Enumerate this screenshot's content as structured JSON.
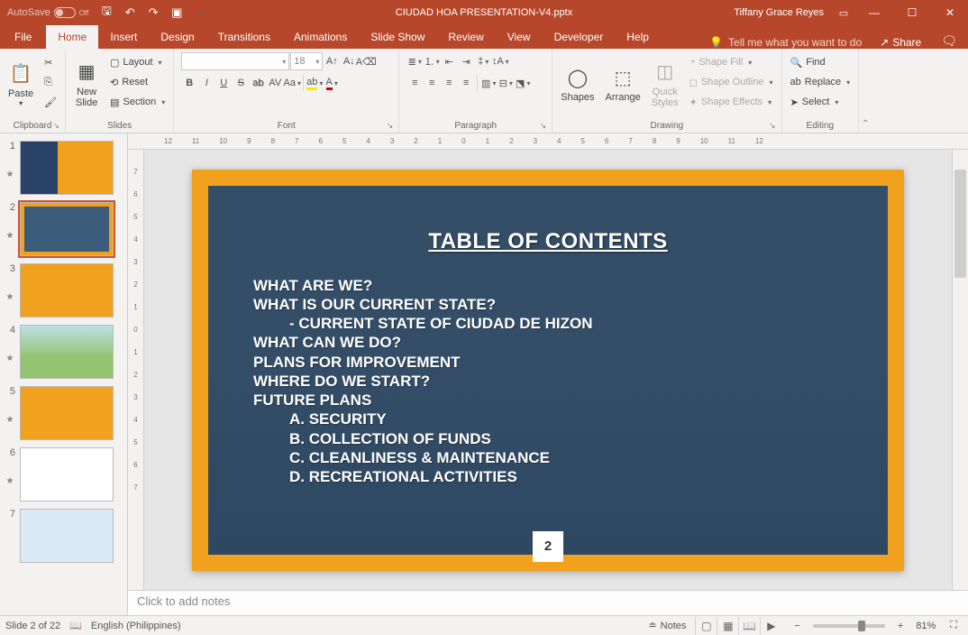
{
  "titlebar": {
    "autosave": "AutoSave",
    "autosave_state": "Off",
    "doc_title": "CIUDAD HOA PRESENTATION-V4.pptx",
    "user": "Tiffany Grace Reyes"
  },
  "tabs": {
    "file": "File",
    "home": "Home",
    "insert": "Insert",
    "design": "Design",
    "transitions": "Transitions",
    "animations": "Animations",
    "slideshow": "Slide Show",
    "review": "Review",
    "view": "View",
    "developer": "Developer",
    "help": "Help",
    "tellme": "Tell me what you want to do",
    "share": "Share"
  },
  "ribbon": {
    "clipboard": {
      "label": "Clipboard",
      "paste": "Paste"
    },
    "slides": {
      "label": "Slides",
      "newslide": "New\nSlide",
      "layout": "Layout",
      "reset": "Reset",
      "section": "Section"
    },
    "font": {
      "label": "Font",
      "size": "18"
    },
    "paragraph": {
      "label": "Paragraph"
    },
    "drawing": {
      "label": "Drawing",
      "shapes": "Shapes",
      "arrange": "Arrange",
      "quick": "Quick\nStyles",
      "fill": "Shape Fill",
      "outline": "Shape Outline",
      "effects": "Shape Effects"
    },
    "editing": {
      "label": "Editing",
      "find": "Find",
      "replace": "Replace",
      "select": "Select"
    }
  },
  "ruler_h": [
    "12",
    "11",
    "10",
    "9",
    "8",
    "7",
    "6",
    "5",
    "4",
    "3",
    "2",
    "1",
    "0",
    "1",
    "2",
    "3",
    "4",
    "5",
    "6",
    "7",
    "8",
    "9",
    "10",
    "11",
    "12"
  ],
  "ruler_v": [
    "7",
    "6",
    "5",
    "4",
    "3",
    "2",
    "1",
    "0",
    "1",
    "2",
    "3",
    "4",
    "5",
    "6",
    "7"
  ],
  "thumbs": {
    "items": [
      "1",
      "2",
      "3",
      "4",
      "5",
      "6",
      "7"
    ]
  },
  "slide": {
    "title": "TABLE OF CONTENTS",
    "lines": {
      "l1": "WHAT ARE WE?",
      "l2": "WHAT IS OUR CURRENT STATE?",
      "l3": "- CURRENT STATE OF CIUDAD DE HIZON",
      "l4": "WHAT CAN WE DO?",
      "l5": "PLANS FOR IMPROVEMENT",
      "l6": "WHERE DO WE START?",
      "l7": "FUTURE PLANS",
      "l8": "A. SECURITY",
      "l9": "B. COLLECTION OF FUNDS",
      "l10": "C. CLEANLINESS & MAINTENANCE",
      "l11": "D. RECREATIONAL ACTIVITIES"
    },
    "page_num": "2"
  },
  "notes": {
    "placeholder": "Click to add notes"
  },
  "status": {
    "slide_pos": "Slide 2 of 22",
    "lang": "English (Philippines)",
    "notes_btn": "Notes",
    "zoom": "81%"
  }
}
